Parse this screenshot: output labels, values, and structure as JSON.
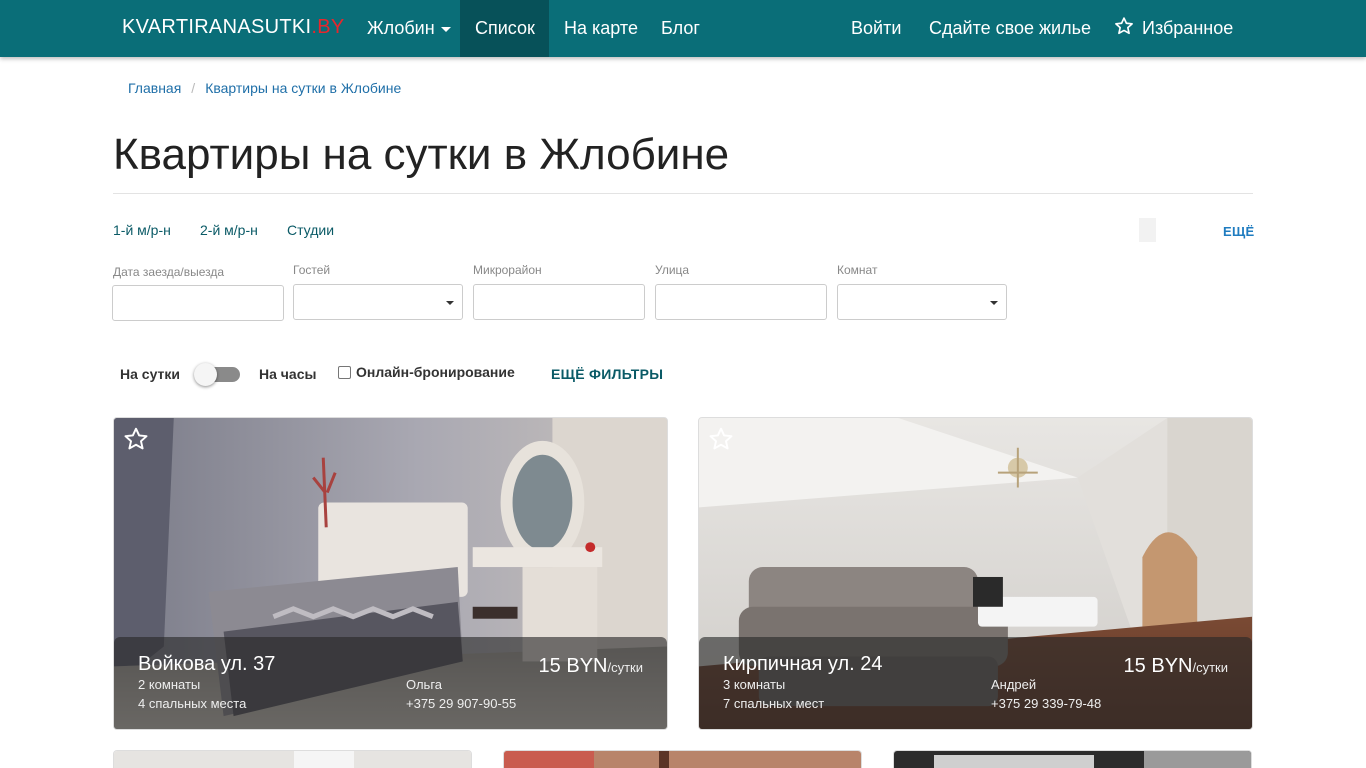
{
  "navbar": {
    "brand": "KVARTIRANASUTKI",
    "brand_tld": ".BY",
    "city_menu": "Жлобин",
    "list": "Список",
    "map": "На карте",
    "blog": "Блог",
    "login": "Войти",
    "rent_out": "Сдайте свое жилье",
    "favorites": "Избранное",
    "bg_color": "#0a6e78"
  },
  "breadcrumb": {
    "home": "Главная",
    "current": "Квартиры на сутки в Жлобине"
  },
  "page_title": "Квартиры на сутки в Жлобине",
  "quick_links": [
    "1-й м/р-н",
    "2-й м/р-н",
    "Студии"
  ],
  "quick_more": "ЕЩЁ",
  "filters": {
    "dates_label": "Дата заезда/выезда",
    "dates_value": "",
    "guests_label": "Гостей",
    "guests_value": "",
    "district_label": "Микрорайон",
    "district_value": "",
    "street_label": "Улица",
    "street_value": "",
    "rooms_label": "Комнат",
    "rooms_value": ""
  },
  "options": {
    "per_day": "На сутки",
    "per_hour": "На часы",
    "online_booking": "Онлайн-бронирование",
    "more_filters": "ЕЩЁ ФИЛЬТРЫ"
  },
  "listings": [
    {
      "title": "Войкова ул. 37",
      "rooms": "2 комнаты",
      "beds": "4 спальных места",
      "owner": "Ольга",
      "phone": "+375 29 907-90-55",
      "price": "15 BYN",
      "price_unit": "/сутки"
    },
    {
      "title": "Кирпичная ул. 24",
      "rooms": "3 комнаты",
      "beds": "7 спальных мест",
      "owner": "Андрей",
      "phone": "+375 29 339-79-48",
      "price": "15 BYN",
      "price_unit": "/сутки"
    }
  ]
}
